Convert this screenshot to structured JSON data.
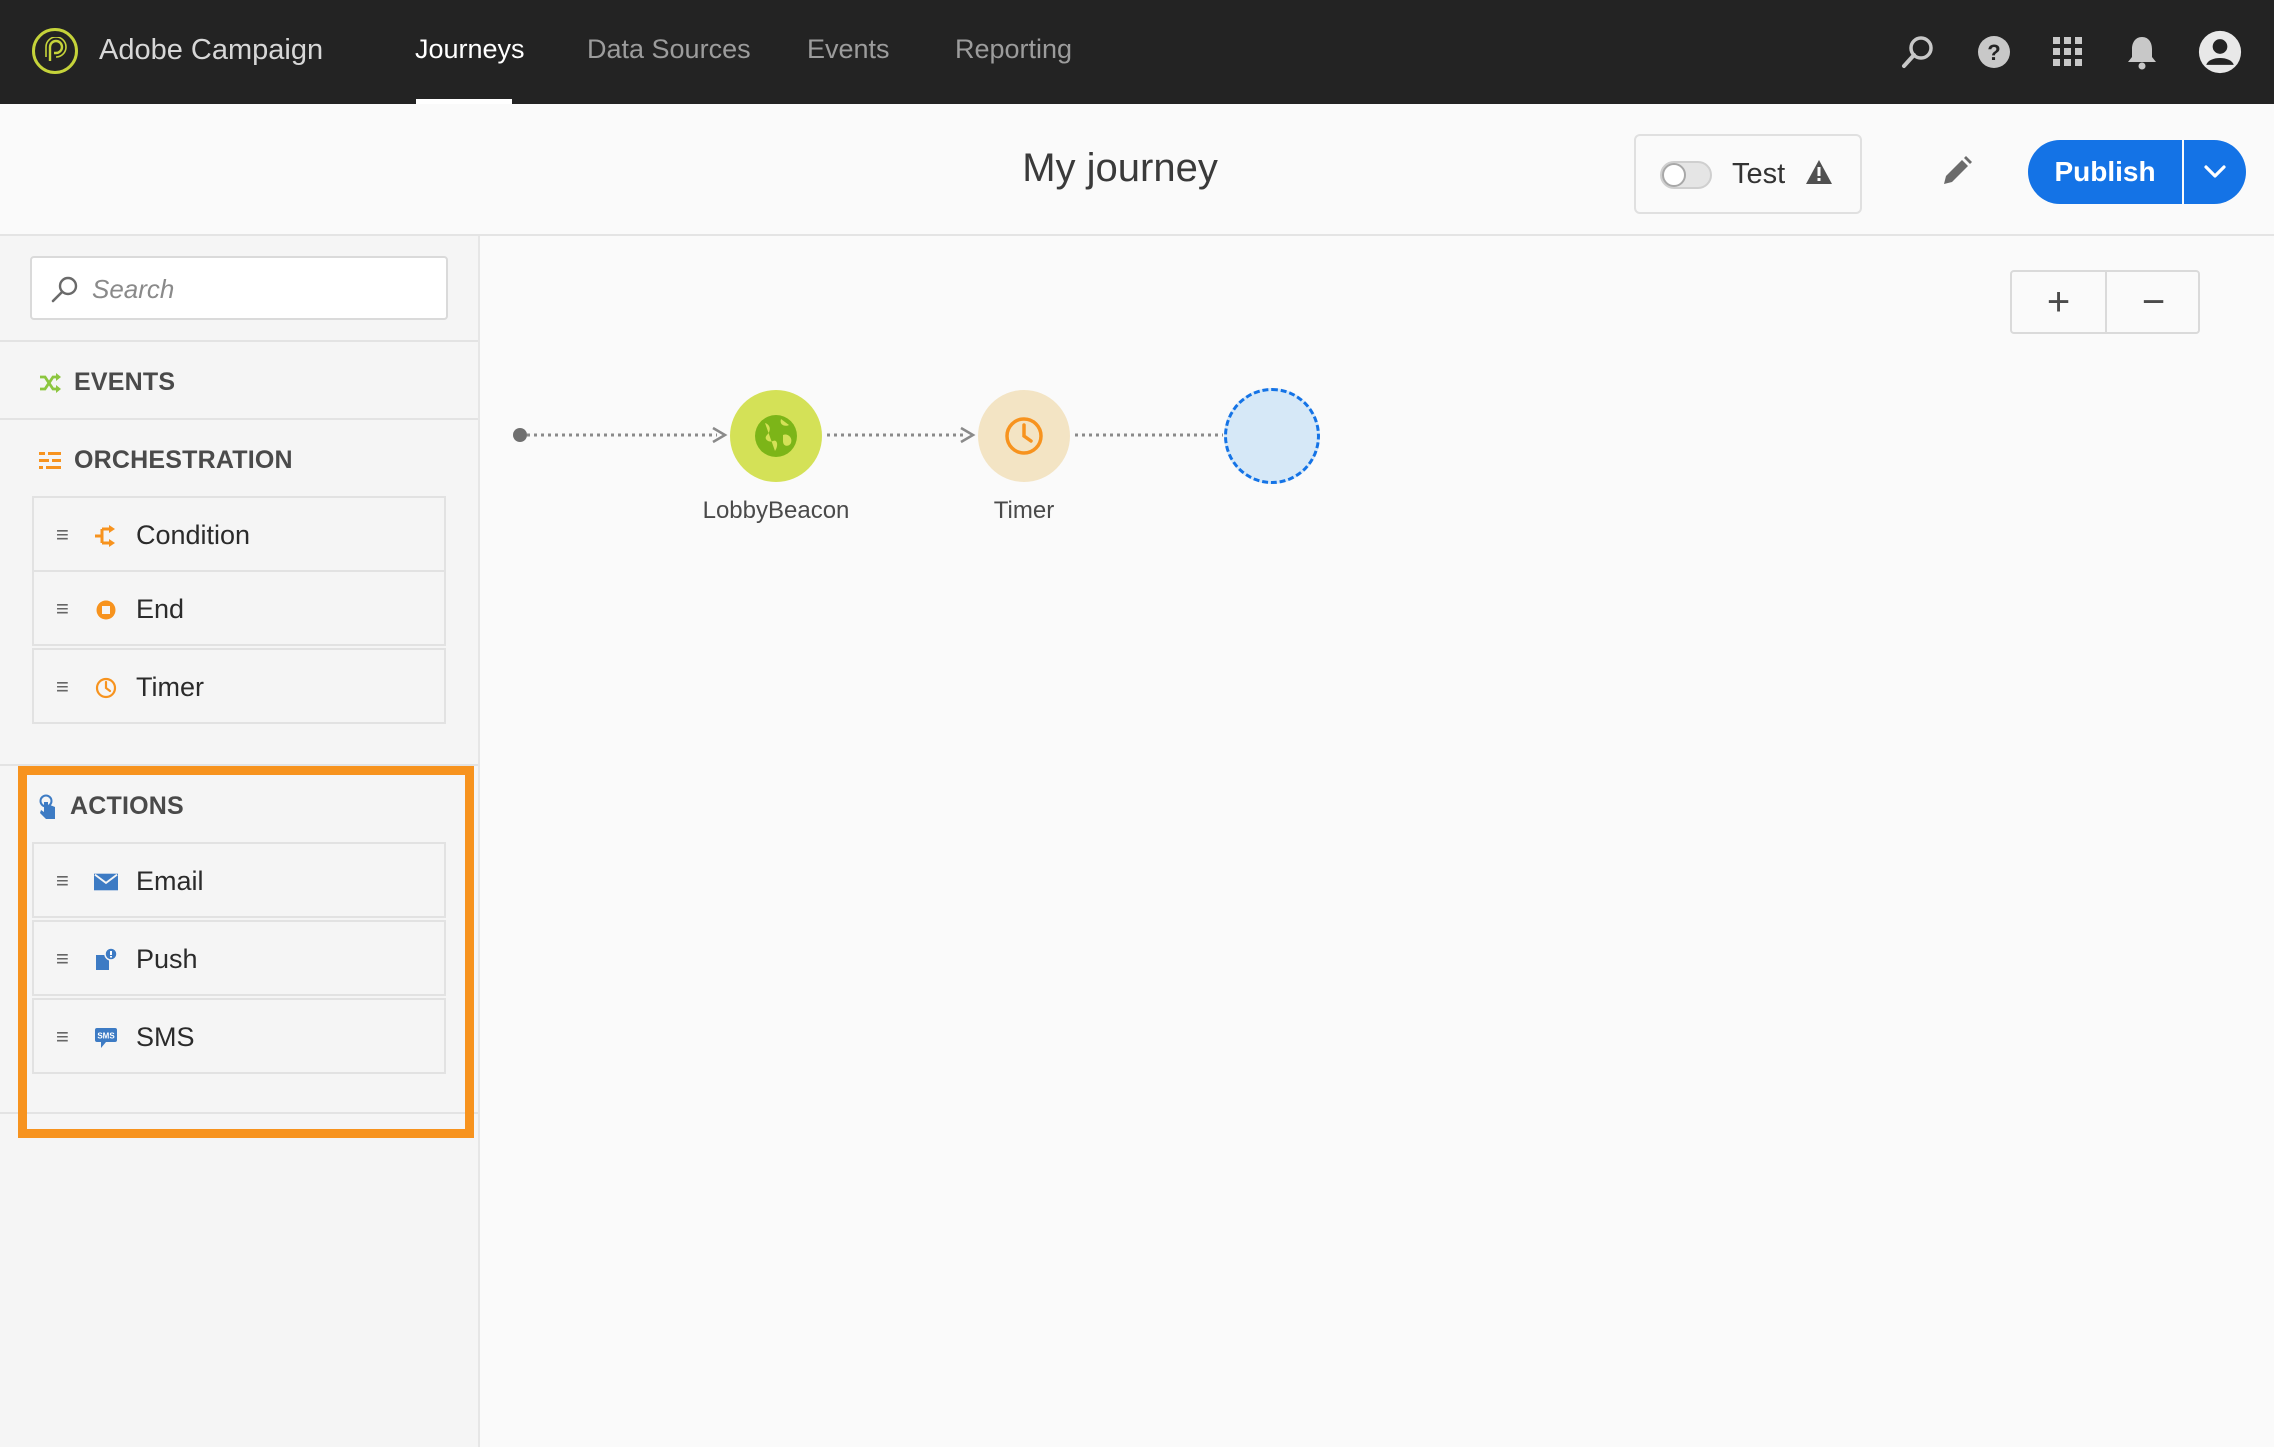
{
  "app": {
    "name": "Adobe Campaign"
  },
  "nav": {
    "tabs": [
      {
        "label": "Journeys",
        "active": true
      },
      {
        "label": "Data Sources",
        "active": false
      },
      {
        "label": "Events",
        "active": false
      },
      {
        "label": "Reporting",
        "active": false
      }
    ],
    "icons": [
      "search-icon",
      "help-icon",
      "apps-grid-icon",
      "notification-bell-icon",
      "user-avatar-icon"
    ]
  },
  "header": {
    "title": "My journey",
    "test_label": "Test",
    "test_enabled": false,
    "publish_label": "Publish"
  },
  "sidebar": {
    "search_placeholder": "Search",
    "sections": {
      "events": {
        "label": "EVENTS",
        "icon": "shuffle-icon"
      },
      "orchestration": {
        "label": "ORCHESTRATION",
        "icon": "orchestration-icon",
        "items": [
          {
            "label": "Condition",
            "icon": "condition-icon"
          },
          {
            "label": "End",
            "icon": "end-icon"
          },
          {
            "label": "Timer",
            "icon": "timer-icon"
          }
        ]
      },
      "actions": {
        "label": "ACTIONS",
        "icon": "touch-icon",
        "items": [
          {
            "label": "Email",
            "icon": "envelope-icon"
          },
          {
            "label": "Push",
            "icon": "push-notification-icon"
          },
          {
            "label": "SMS",
            "icon": "sms-icon"
          }
        ]
      }
    }
  },
  "canvas": {
    "zoom_in": "+",
    "zoom_out": "−",
    "nodes": [
      {
        "label": "LobbyBeacon",
        "icon": "globe-icon"
      },
      {
        "label": "Timer",
        "icon": "clock-icon"
      },
      {
        "label": "",
        "icon": "empty-drop-target"
      }
    ]
  },
  "colors": {
    "topbar": "#232323",
    "publish": "#1473e6",
    "highlight": "#f7931e",
    "event_node": "#d4e157",
    "timer_node": "#f3e4c4",
    "drop_target": "#d6e8f7"
  }
}
